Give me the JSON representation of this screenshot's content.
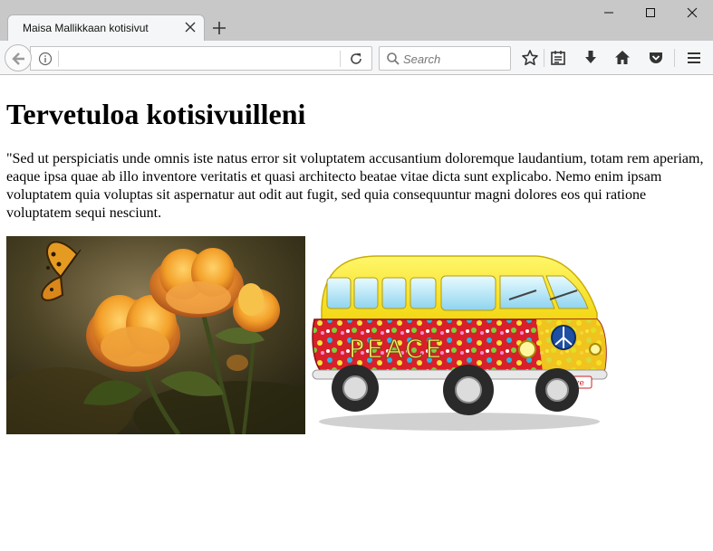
{
  "browser": {
    "tab": {
      "title": "Maisa Mallikkaan kotisivut"
    },
    "urlbar": {
      "value": ""
    },
    "search": {
      "placeholder": "Search"
    },
    "toolbar_icons": [
      "back-arrow-icon",
      "info-icon",
      "reload-icon",
      "search-icon",
      "bookmark-star-icon",
      "reading-list-icon",
      "downloads-icon",
      "home-icon",
      "pocket-icon",
      "menu-icon"
    ],
    "window_controls": [
      "minimize-icon",
      "maximize-icon",
      "close-icon"
    ]
  },
  "page": {
    "heading": "Tervetuloa kotisivuilleni",
    "intro": "\"Sed ut perspiciatis unde omnis iste natus error sit voluptatem accusantium doloremque laudantium, totam rem aperiam, eaque ipsa quae ab illo inventore veritatis et quasi architecto beatae vitae dicta sunt explicabo. Nemo enim ipsam voluptatem quia voluptas sit aspernatur aut odit aut fugit, sed quia consequuntur magni dolores eos qui ratione voluptatem sequi nesciunt.",
    "images": [
      {
        "name": "flowers-butterfly-photo"
      },
      {
        "name": "hippie-bus-illustration",
        "bus_text": "PEACE",
        "plate_text": "Love"
      }
    ]
  },
  "colors": {
    "tabstrip": "#c8c8c8",
    "toolbar": "#f5f6f7",
    "bus_body": "#d8202a",
    "bus_roof": "#f7ec1a"
  }
}
